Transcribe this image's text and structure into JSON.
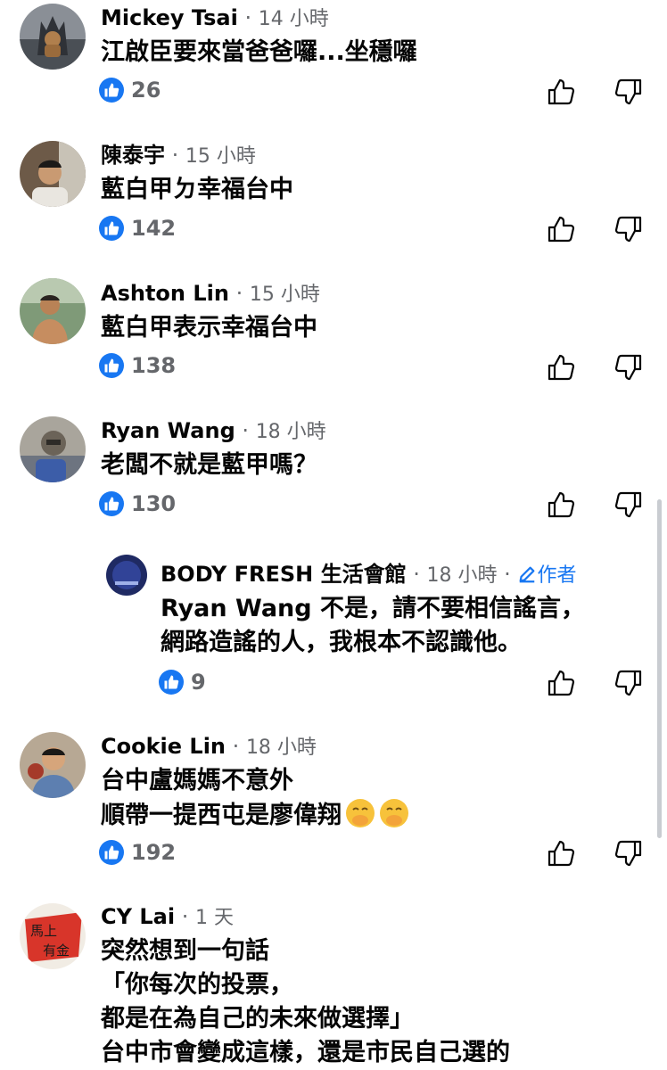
{
  "comments": [
    {
      "name": "Mickey Tsai",
      "time": "14 小時",
      "lines": [
        "江啟臣要來當爸爸囉...坐穩囉"
      ],
      "likes": "26"
    },
    {
      "name": "陳泰宇",
      "time": "15 小時",
      "lines": [
        "藍白甲ㄉ幸福台中"
      ],
      "likes": "142"
    },
    {
      "name": "Ashton Lin",
      "time": "15 小時",
      "lines": [
        "藍白甲表示幸福台中"
      ],
      "likes": "138"
    },
    {
      "name": "Ryan Wang",
      "time": "18 小時",
      "lines": [
        "老闆不就是藍甲嗎？"
      ],
      "likes": "130"
    },
    {
      "name": "BODY FRESH 生活會館",
      "time": "18 小時",
      "author": "作者",
      "lines": [
        "Ryan Wang 不是，請不要相信謠言，",
        "網路造謠的人，我根本不認識他。"
      ],
      "likes": "9"
    },
    {
      "name": "Cookie Lin",
      "time": "18 小時",
      "lines": [
        "台中盧媽媽不意外",
        "順帶一提西屯是廖偉翔"
      ],
      "likes": "192"
    },
    {
      "name": "CY Lai",
      "time": "1 天",
      "lines": [
        "突然想到一句話",
        "「你每次的投票，",
        "都是在為自己的未來做選擇」",
        "台中市會變成這樣，還是市民自己選的"
      ]
    }
  ],
  "separator": "·",
  "avatar6_text": [
    "馬上",
    "有金"
  ],
  "icons": {
    "like_badge": "thumbs-up-icon",
    "like": "like-icon",
    "dislike": "dislike-icon",
    "author": "pencil-icon",
    "emoji": "hand-over-mouth-emoji"
  },
  "colors": {
    "accent": "#1877f2",
    "meta": "#65676b",
    "text": "#050505"
  }
}
